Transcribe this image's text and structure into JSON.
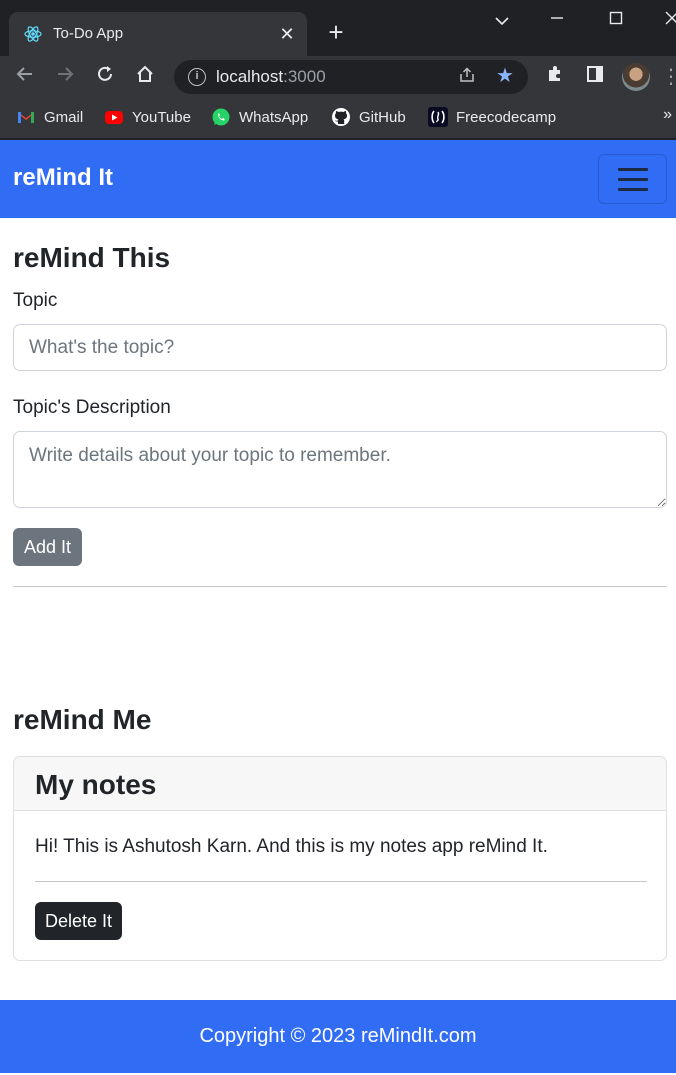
{
  "browser": {
    "tab": {
      "title": "To-Do App"
    },
    "address": {
      "host": "localhost",
      "port": ":3000"
    },
    "bookmarks": [
      {
        "label": "Gmail",
        "icon": "gmail-icon"
      },
      {
        "label": "YouTube",
        "icon": "youtube-icon"
      },
      {
        "label": "WhatsApp",
        "icon": "whatsapp-icon"
      },
      {
        "label": "GitHub",
        "icon": "github-icon"
      },
      {
        "label": "Freecodecamp",
        "icon": "freecodecamp-icon"
      }
    ],
    "bookmarks_more": "»"
  },
  "navbar": {
    "brand": "reMind It"
  },
  "form": {
    "heading": "reMind This",
    "topic_label": "Topic",
    "topic_placeholder": "What's the topic?",
    "desc_label": "Topic's Description",
    "desc_placeholder": "Write details about your topic to remember.",
    "submit_label": "Add It"
  },
  "notes": {
    "heading": "reMind Me",
    "items": [
      {
        "title": "My notes",
        "text": "Hi! This is Ashutosh Karn. And this is my notes app reMind It.",
        "delete_label": "Delete It"
      }
    ]
  },
  "footer": {
    "text": "Copyright © 2023 reMindIt.com"
  },
  "colors": {
    "brand_blue": "#316cf4",
    "secondary_button": "#6c757d",
    "dark_button": "#212529",
    "star_blue": "#8ab4f8"
  }
}
